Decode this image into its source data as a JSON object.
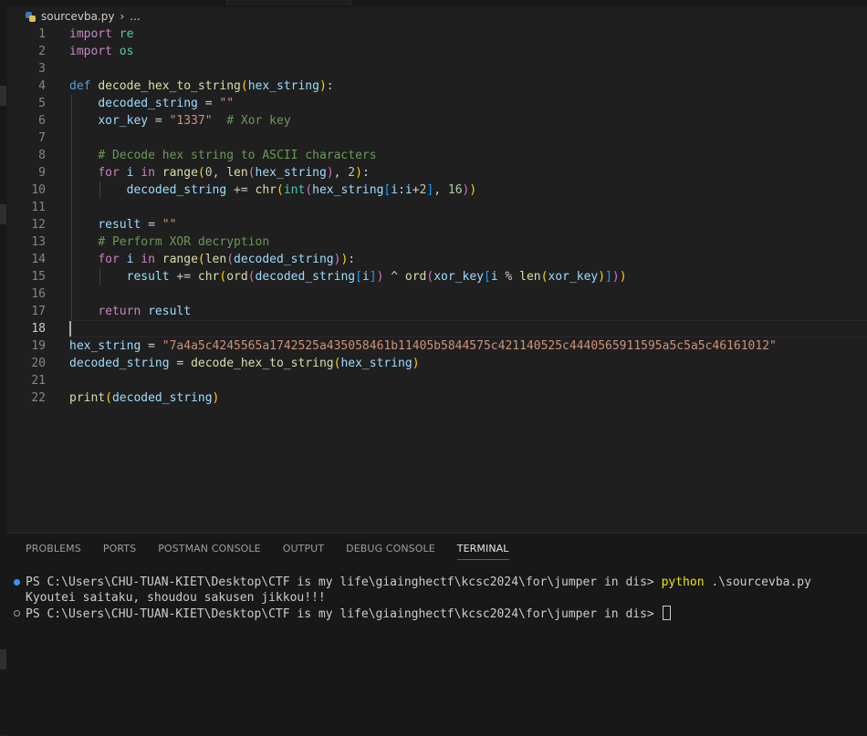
{
  "breadcrumb": {
    "file": "sourcevba.py",
    "separator": "›",
    "ellipsis": "..."
  },
  "editor": {
    "line_numbers": [
      "1",
      "2",
      "3",
      "4",
      "5",
      "6",
      "7",
      "8",
      "9",
      "10",
      "11",
      "12",
      "13",
      "14",
      "15",
      "16",
      "17",
      "18",
      "19",
      "20",
      "21",
      "22"
    ],
    "active_line": "18",
    "tokens": {
      "import": "import",
      "re": "re",
      "os": "os",
      "def": "def",
      "func_name": "decode_hex_to_string",
      "param": "hex_string",
      "decoded_string": "decoded_string",
      "xor_key": "xor_key",
      "empty_str": "\"\"",
      "key_str": "\"1337\"",
      "xor_comment": "# Xor key",
      "decode_comment": "# Decode hex string to ASCII characters",
      "for": "for",
      "i": "i",
      "in": "in",
      "range": "range",
      "len": "len",
      "chr": "chr",
      "int": "int",
      "ord": "ord",
      "zero": "0",
      "two": "2",
      "sixteen": "16",
      "result": "result",
      "xor_decrypt_comment": "# Perform XOR decryption",
      "return": "return",
      "print": "print",
      "hex_value": "\"7a4a5c4245565a1742525a435058461b11405b5844575c421140525c4440565911595a5c5a5c46161012\""
    }
  },
  "panel": {
    "tabs": [
      "PROBLEMS",
      "PORTS",
      "POSTMAN CONSOLE",
      "OUTPUT",
      "DEBUG CONSOLE",
      "TERMINAL"
    ],
    "active_tab": "TERMINAL"
  },
  "terminal": {
    "prompt": "PS C:\\Users\\CHU-TUAN-KIET\\Desktop\\CTF is my life\\giainghectf\\kcsc2024\\for\\jumper in dis>",
    "command": "python",
    "command_arg": ".\\sourcevba.py",
    "output": "Kyoutei saitaku, shoudou sakusen jikkou!!!"
  },
  "colors": {
    "background": "#1f1f1f",
    "keyword": "#569cd6",
    "control": "#c586c0",
    "function": "#dcdcaa",
    "variable": "#9cdcfe",
    "string": "#ce9178",
    "number": "#b5cea8",
    "comment": "#6a9955",
    "accent": "#0078d4"
  }
}
